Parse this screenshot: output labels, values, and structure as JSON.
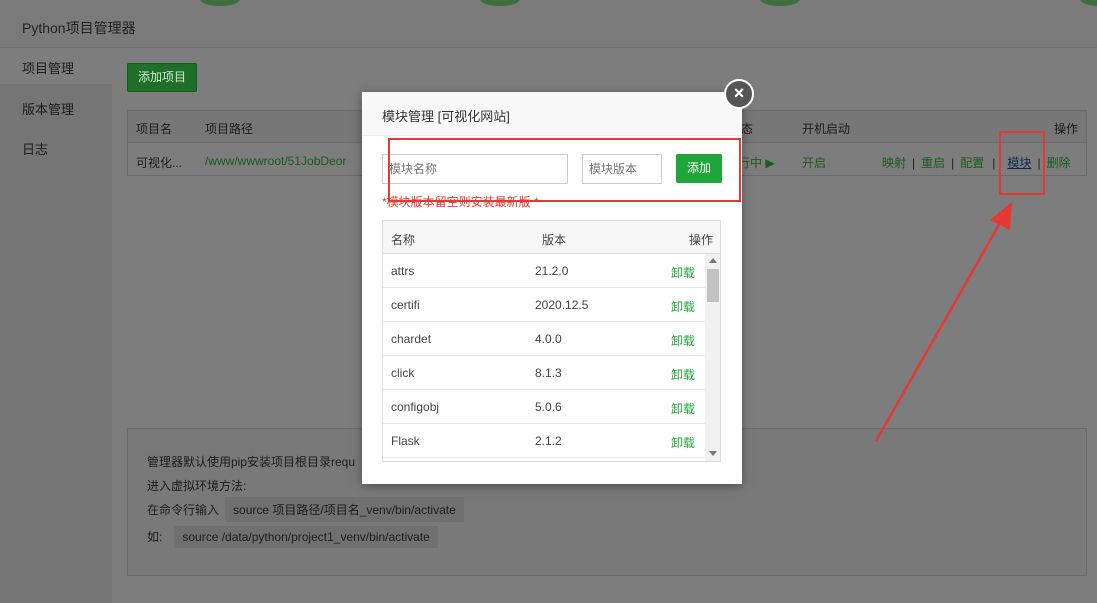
{
  "window": {
    "title": "Python项目管理器"
  },
  "sidebar": {
    "items": [
      {
        "label": "项目管理"
      },
      {
        "label": "版本管理"
      },
      {
        "label": "日志"
      }
    ]
  },
  "main": {
    "add_project_label": "添加项目",
    "table": {
      "headers": {
        "name": "项目名",
        "path": "项目路径",
        "status": "态",
        "autostart": "开机启动",
        "actions": "操作"
      },
      "row": {
        "name": "可视化...",
        "path": "/www/wwwroot/51JobDeor",
        "status": "行中 ▶",
        "autostart": "开启",
        "actions": {
          "map": "映射",
          "restart": "重启",
          "config": "配置",
          "module": "模块",
          "delete": "删除"
        }
      }
    },
    "info": {
      "line1": "管理器默认使用pip安装项目根目录requ",
      "line2": "进入虚拟环境方法:",
      "line3_prefix": "在命令行输入",
      "line3_code": "source 项目路径/项目名_venv/bin/activate",
      "line4_prefix": "如:",
      "line4_code": "source /data/python/project1_venv/bin/activate"
    }
  },
  "modal": {
    "title": "模块管理 [可视化网站]",
    "close_icon": "close-icon",
    "name_placeholder": "模块名称",
    "version_placeholder": "模块版本",
    "add_label": "添加",
    "hint": "*模块版本留空则安装最新版 *",
    "table": {
      "headers": {
        "name": "名称",
        "version": "版本",
        "actions": "操作"
      },
      "rows": [
        {
          "name": "attrs",
          "version": "21.2.0",
          "action": "卸载"
        },
        {
          "name": "certifi",
          "version": "2020.12.5",
          "action": "卸载"
        },
        {
          "name": "chardet",
          "version": "4.0.0",
          "action": "卸载"
        },
        {
          "name": "click",
          "version": "8.1.3",
          "action": "卸载"
        },
        {
          "name": "configobj",
          "version": "5.0.6",
          "action": "卸载"
        },
        {
          "name": "Flask",
          "version": "2.1.2",
          "action": "卸载"
        }
      ]
    }
  },
  "colors": {
    "accent_green": "#20a53a",
    "annotation_red": "#e53935"
  }
}
